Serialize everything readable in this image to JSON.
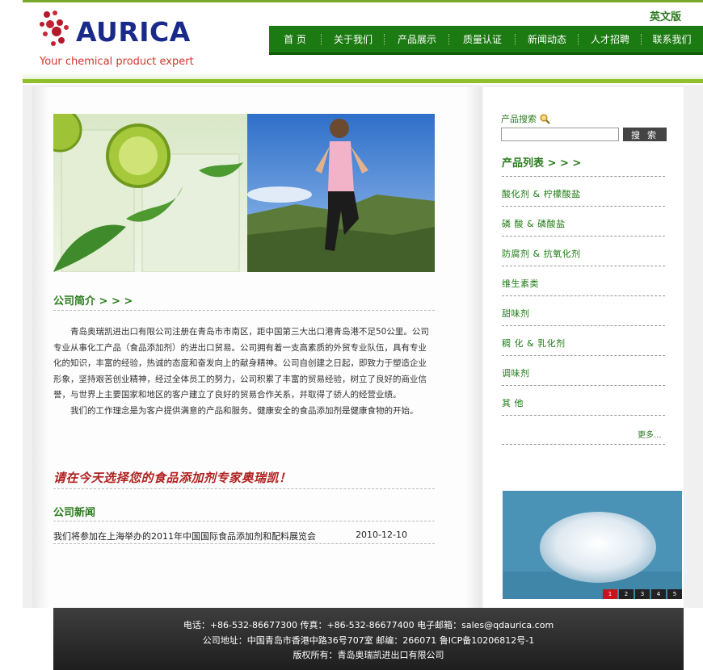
{
  "header": {
    "brand": "AURICA",
    "slogan": "Your chemical product expert",
    "lang_link": "英文版"
  },
  "nav": {
    "items": [
      "首  页",
      "关于我们",
      "产品展示",
      "质量认证",
      "新闻动态",
      "人才招聘",
      "联系我们"
    ]
  },
  "intro": {
    "title": "公司简介 > > >",
    "p1": "青岛奥瑞凯进出口有限公司注册在青岛市市南区，距中国第三大出口港青岛港不足50公里。公司专业从事化工产品（食品添加剂）的进出口贸易。公司拥有着一支高素质的外贸专业队伍，具有专业化的知识，丰富的经验，热诚的态度和奋发向上的献身精神。公司自创建之日起，即致力于塑造企业形象，坚持艰苦创业精神，经过全体员工的努力，公司积累了丰富的贸易经验，树立了良好的商业信誉，与世界上主要国家和地区的客户建立了良好的贸易合作关系，并取得了骄人的经营业绩。",
    "p2": "我们的工作理念是为客户提供满意的产品和服务。健康安全的食品添加剂是健康食物的开始。"
  },
  "slogan": "请在今天选择您的食品添加剂专家奥瑞凯！",
  "news": {
    "title": "公司新闻",
    "items": [
      {
        "text": "我们将参加在上海举办的2011年中国国际食品添加剂和配料展览会",
        "date": "2010-12-10"
      }
    ]
  },
  "sidebar": {
    "search_label": "产品搜索",
    "search_placeholder": "",
    "search_button": "搜 索",
    "categories_title": "产品列表 > > >",
    "categories": [
      "酸化剂 & 柠檬酸盐",
      "磷  酸  & 磷酸盐",
      "防腐剂 & 抗氧化剂",
      "维生素类",
      "甜味剂",
      "稠 化 & 乳化剂",
      "调味剂",
      "其  他"
    ],
    "more": "更多..."
  },
  "pager": [
    "1",
    "2",
    "3",
    "4",
    "5"
  ],
  "footer": {
    "line1": "电话：+86-532-86677300     传真：+86-532-86677400     电子邮箱：sales@qdaurica.com",
    "line2": "公司地址：中国青岛市香港中路36号707室     邮编：266071      鲁ICP备10206812号-1",
    "line3": "版权所有：青岛奥瑞凯进出口有限公司"
  },
  "colors": {
    "brand_green": "#1c7a12",
    "accent_red": "#c8141b",
    "logo_blue": "#1a2a8a"
  }
}
